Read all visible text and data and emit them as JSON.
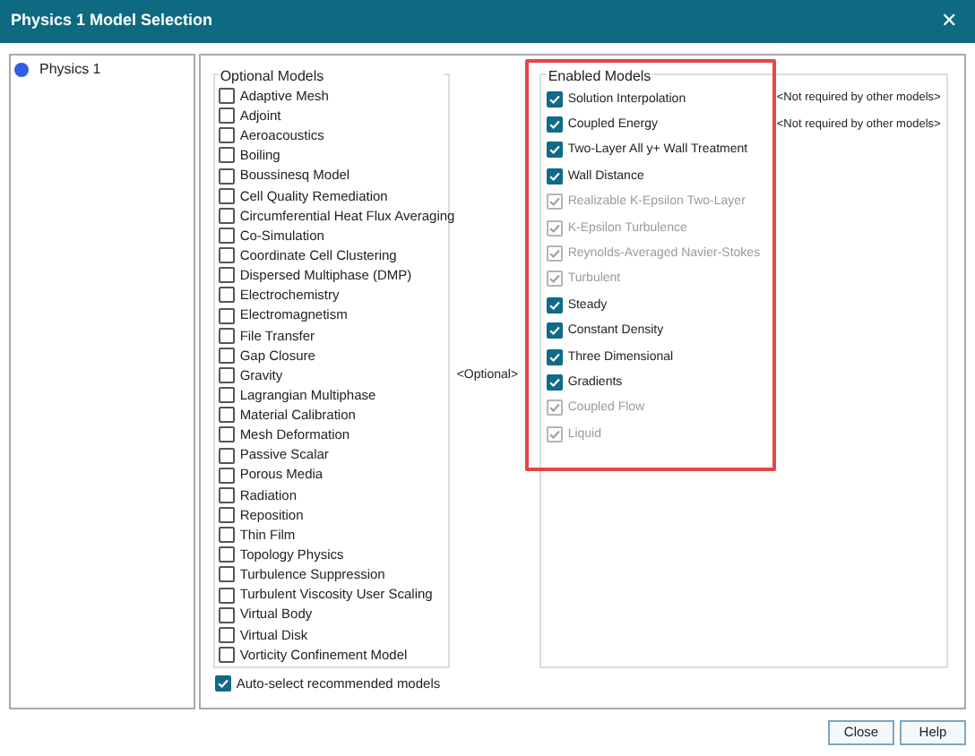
{
  "window": {
    "title": "Physics 1 Model Selection",
    "close": "✕"
  },
  "tree": {
    "items": [
      {
        "label": "Physics 1",
        "color": "#2f5fe0"
      }
    ]
  },
  "optional_models": {
    "title": "Optional Models",
    "items": [
      {
        "label": "Adaptive Mesh",
        "checked": false
      },
      {
        "label": "Adjoint",
        "checked": false
      },
      {
        "label": "Aeroacoustics",
        "checked": false
      },
      {
        "label": "Boiling",
        "checked": false
      },
      {
        "label": "Boussinesq Model",
        "checked": false
      },
      {
        "label": "Cell Quality Remediation",
        "checked": false
      },
      {
        "label": "Circumferential Heat Flux Averaging",
        "checked": false
      },
      {
        "label": "Co-Simulation",
        "checked": false
      },
      {
        "label": "Coordinate Cell Clustering",
        "checked": false
      },
      {
        "label": "Dispersed Multiphase (DMP)",
        "checked": false
      },
      {
        "label": "Electrochemistry",
        "checked": false
      },
      {
        "label": "Electromagnetism",
        "checked": false
      },
      {
        "label": "File Transfer",
        "checked": false
      },
      {
        "label": "Gap Closure",
        "checked": false
      },
      {
        "label": "Gravity",
        "checked": false
      },
      {
        "label": "Lagrangian Multiphase",
        "checked": false
      },
      {
        "label": "Material Calibration",
        "checked": false
      },
      {
        "label": "Mesh Deformation",
        "checked": false
      },
      {
        "label": "Passive Scalar",
        "checked": false
      },
      {
        "label": "Porous Media",
        "checked": false
      },
      {
        "label": "Radiation",
        "checked": false
      },
      {
        "label": "Reposition",
        "checked": false
      },
      {
        "label": "Thin Film",
        "checked": false
      },
      {
        "label": "Topology Physics",
        "checked": false
      },
      {
        "label": "Turbulence Suppression",
        "checked": false
      },
      {
        "label": "Turbulent Viscosity User Scaling",
        "checked": false
      },
      {
        "label": "Virtual Body",
        "checked": false
      },
      {
        "label": "Virtual Disk",
        "checked": false
      },
      {
        "label": "Vorticity Confinement Model",
        "checked": false
      }
    ]
  },
  "auto_select": {
    "label": "Auto-select recommended models",
    "checked": true
  },
  "optional_hint": "<Optional>",
  "enabled_models": {
    "title": "Enabled Models",
    "items": [
      {
        "label": "Solution Interpolation",
        "checked": true,
        "disabled": false,
        "note": "<Not required by other models>"
      },
      {
        "label": "Coupled Energy",
        "checked": true,
        "disabled": false,
        "note": "<Not required by other models>"
      },
      {
        "label": "Two-Layer All y+ Wall Treatment",
        "checked": true,
        "disabled": false
      },
      {
        "label": "Wall Distance",
        "checked": true,
        "disabled": false
      },
      {
        "label": "Realizable K-Epsilon Two-Layer",
        "checked": true,
        "disabled": true
      },
      {
        "label": "K-Epsilon Turbulence",
        "checked": true,
        "disabled": true
      },
      {
        "label": "Reynolds-Averaged Navier-Stokes",
        "checked": true,
        "disabled": true
      },
      {
        "label": "Turbulent",
        "checked": true,
        "disabled": true
      },
      {
        "label": "Steady",
        "checked": true,
        "disabled": false
      },
      {
        "label": "Constant Density",
        "checked": true,
        "disabled": false
      },
      {
        "label": "Three Dimensional",
        "checked": true,
        "disabled": false
      },
      {
        "label": "Gradients",
        "checked": true,
        "disabled": false
      },
      {
        "label": "Coupled Flow",
        "checked": true,
        "disabled": true
      },
      {
        "label": "Liquid",
        "checked": true,
        "disabled": true
      }
    ]
  },
  "buttons": [
    {
      "label": "Close"
    },
    {
      "label": "Help"
    }
  ]
}
